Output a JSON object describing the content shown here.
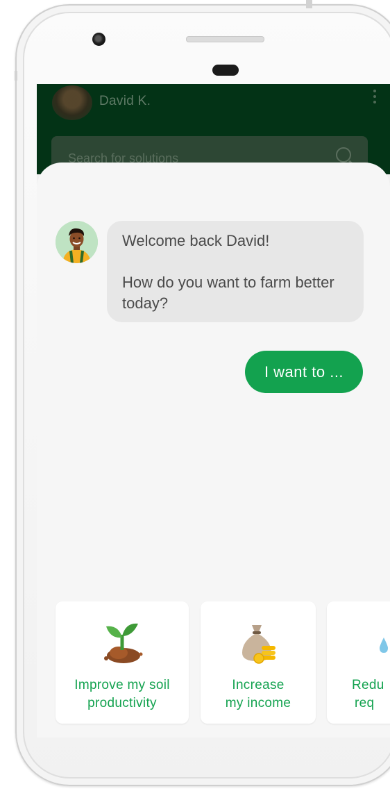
{
  "header": {
    "user_name": "David K.",
    "search_placeholder": "Search for solutions"
  },
  "chat": {
    "greeting_line1": "Welcome back David!",
    "greeting_line2": "How do you want to farm better today?",
    "user_reply": "I want to ..."
  },
  "suggestions": [
    {
      "line1": "Improve my soil",
      "line2": "productivity",
      "icon": "sprout-icon"
    },
    {
      "line1": "Increase",
      "line2": "my income",
      "icon": "money-bag-icon"
    },
    {
      "line1": "Redu",
      "line2": "req",
      "icon": "water-drop-icon"
    }
  ],
  "colors": {
    "brand_green": "#13a24f",
    "header_dark_green": "#033316",
    "bubble_gray": "#e7e7e7"
  }
}
